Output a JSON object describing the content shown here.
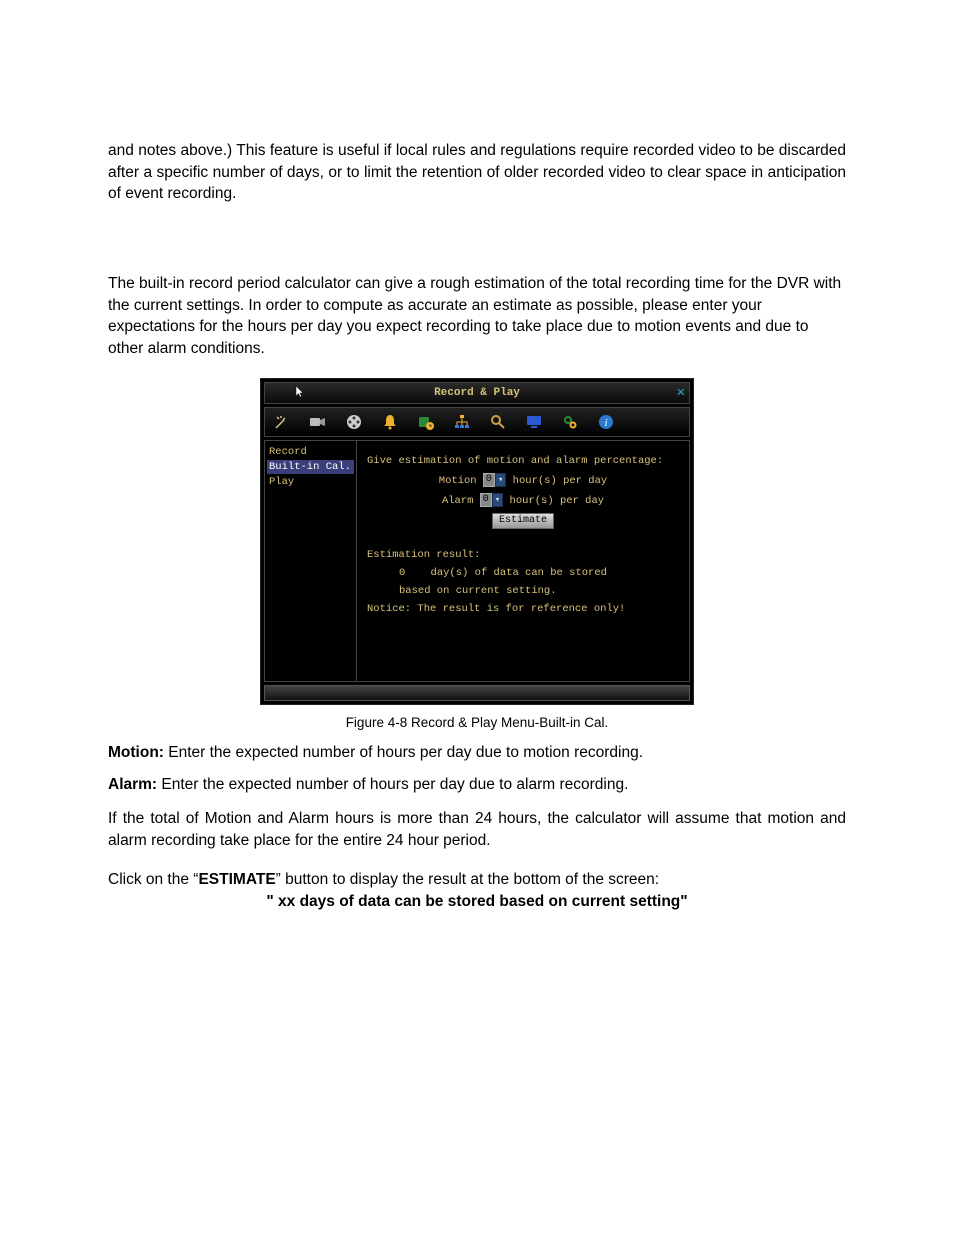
{
  "paragraphs": {
    "p1": "and notes above.) This feature is useful if local rules and regulations require recorded video to be discarded after a specific number of days, or to limit the retention of older recorded video to clear space in anticipation of event recording.",
    "p2": "The built-in record period calculator can give a rough estimation of the total recording time for the DVR with the current settings. In order to compute as accurate an estimate as possible, please enter your expectations for the hours per day you expect recording to take place due to motion events and due to other alarm conditions."
  },
  "dvr": {
    "title": "Record & Play",
    "sidebar": {
      "items": [
        "Record",
        "Built-in Cal.",
        "Play"
      ],
      "active_index": 1
    },
    "main": {
      "heading": "Give estimation of motion and alarm percentage:",
      "motion_label": "Motion",
      "alarm_label": "Alarm",
      "motion_value": "0",
      "alarm_value": "0",
      "hours_suffix": "hour(s) per day",
      "estimate_btn": "Estimate",
      "result_heading": "Estimation result:",
      "result_days": "0",
      "result_line1_suffix": "day(s) of data can be stored",
      "result_line2": "based on current setting.",
      "notice": "Notice: The result is for reference only!"
    },
    "toolbar_icons": [
      "wand",
      "camera",
      "reel",
      "bell",
      "clock",
      "network",
      "search",
      "monitor",
      "gears",
      "info"
    ]
  },
  "caption": "Figure 4-8  Record & Play Menu-Built-in Cal.",
  "defs": {
    "motion_label": "Motion:",
    "motion_text": " Enter the expected number of hours per day due to motion recording.",
    "alarm_label": "Alarm:",
    "alarm_text": " Enter the expected number of hours per day due to alarm recording."
  },
  "p3": "If the total of Motion and Alarm hours is more than 24 hours, the calculator will assume that motion and alarm recording take place for the entire 24 hour period.",
  "click_line": {
    "prefix": "Click on the “",
    "estimate": "ESTIMATE",
    "suffix": "” button to display the result at the bottom of the screen:"
  },
  "result_quote": "\" xx days of data can be stored based on current setting\""
}
